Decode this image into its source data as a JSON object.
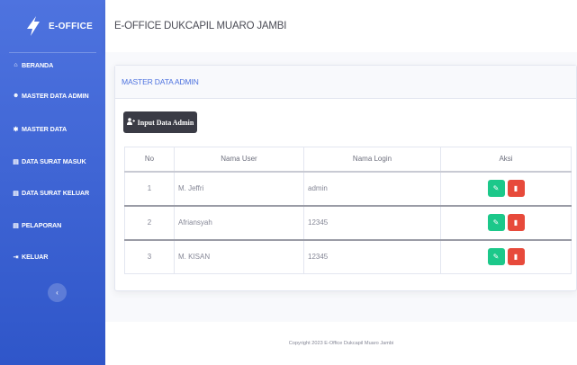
{
  "sidebar": {
    "brand": "E-OFFICE",
    "items": [
      {
        "label": "BERANDA",
        "icon": "home-icon",
        "glyph": "⌂"
      },
      {
        "label": "MASTER DATA ADMIN",
        "icon": "users-icon",
        "glyph": "☻"
      },
      {
        "label": "MASTER DATA",
        "icon": "cog-icon",
        "glyph": "✱"
      },
      {
        "label": "DATA SURAT MASUK",
        "icon": "file-icon",
        "glyph": "▤"
      },
      {
        "label": "DATA SURAT KELUAR",
        "icon": "file-icon",
        "glyph": "▤"
      },
      {
        "label": "PELAPORAN",
        "icon": "file-icon",
        "glyph": "▤"
      },
      {
        "label": "KELUAR",
        "icon": "sign-out-icon",
        "glyph": "⇥"
      }
    ],
    "toggle_glyph": "‹"
  },
  "topbar": {
    "title": "E-OFFICE DUKCAPIL MUARO JAMBI"
  },
  "card": {
    "title": "MASTER DATA ADMIN",
    "input_button": "Input Data Admin",
    "input_button_icon": "user-plus-icon"
  },
  "table": {
    "headers": [
      "No",
      "Nama User",
      "Nama Login",
      "Aksi"
    ],
    "rows": [
      {
        "no": "1",
        "nama_user": "M. Jeffri",
        "nama_login": "admin"
      },
      {
        "no": "2",
        "nama_user": "Afriansyah",
        "nama_login": "12345"
      },
      {
        "no": "3",
        "nama_user": "M. KISAN",
        "nama_login": "12345"
      }
    ],
    "edit_glyph": "✎",
    "delete_glyph": "▮"
  },
  "footer": {
    "text": "Copyright 2023 E-Office Dukcapil Muaro Jambi"
  },
  "colors": {
    "sidebar": "#4e73df",
    "edit": "#1cc88a",
    "delete": "#e74a3b",
    "button_dark": "#3a3b45"
  }
}
